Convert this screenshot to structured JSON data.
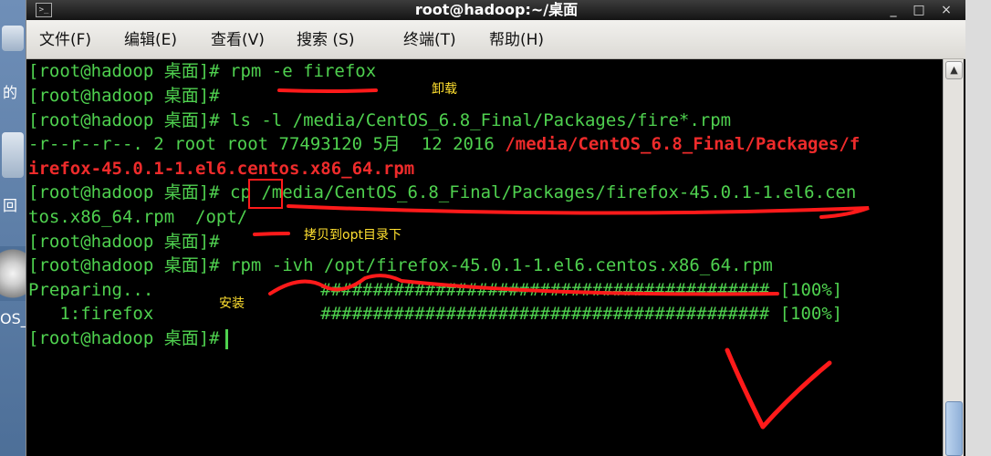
{
  "window": {
    "title": "root@hadoop:~/桌面",
    "minimize": "_",
    "maximize": "□",
    "close": "×"
  },
  "menu": [
    "文件(F)",
    "编辑(E)",
    "查看(V)",
    "搜索 (S)",
    "终端(T)",
    "帮助(H)"
  ],
  "desktop": {
    "label_1": "的",
    "label_2": "回",
    "label_3": "OS_"
  },
  "terminal": {
    "prompt": "[root@hadoop 桌面]#",
    "lines": [
      {
        "prompt": "[root@hadoop 桌面]#",
        "text": " rpm -e firefox"
      },
      {
        "prompt": "[root@hadoop 桌面]#",
        "text": ""
      },
      {
        "prompt": "[root@hadoop 桌面]#",
        "text": " ls -l /media/CentOS_6.8_Final/Packages/fire*.rpm"
      },
      {
        "text": "-r--r--r--. 2 root root 77493120 5月  12 2016 ",
        "red": "/media/CentOS_6.8_Final/Packages/f"
      },
      {
        "red": "irefox-45.0.1-1.el6.centos.x86_64.rpm"
      },
      {
        "prompt": "[root@hadoop 桌面]#",
        "text": " cp /media/CentOS_6.8_Final/Packages/firefox-45.0.1-1.el6.cen"
      },
      {
        "text": "tos.x86_64.rpm  /opt/"
      },
      {
        "prompt": "[root@hadoop 桌面]#",
        "text": ""
      },
      {
        "prompt": "[root@hadoop 桌面]#",
        "text": " rpm -ivh /opt/firefox-45.0.1-1.el6.centos.x86_64.rpm"
      },
      {
        "text": "Preparing...                ########################################### [100%]"
      },
      {
        "text": "   1:firefox                ########################################### [100%]"
      },
      {
        "prompt": "[root@hadoop 桌面]#",
        "text": ""
      }
    ]
  },
  "annotations": {
    "uninstall": "卸载",
    "copy_to_opt": "拷贝到opt目录下",
    "install": "安装"
  },
  "colors": {
    "terminal_text": "#4fd14f",
    "terminal_bg": "#000000",
    "highlight_red": "#ee2b2b",
    "annotation_yellow": "#ffe030",
    "markup_red": "#ff1a1a"
  }
}
